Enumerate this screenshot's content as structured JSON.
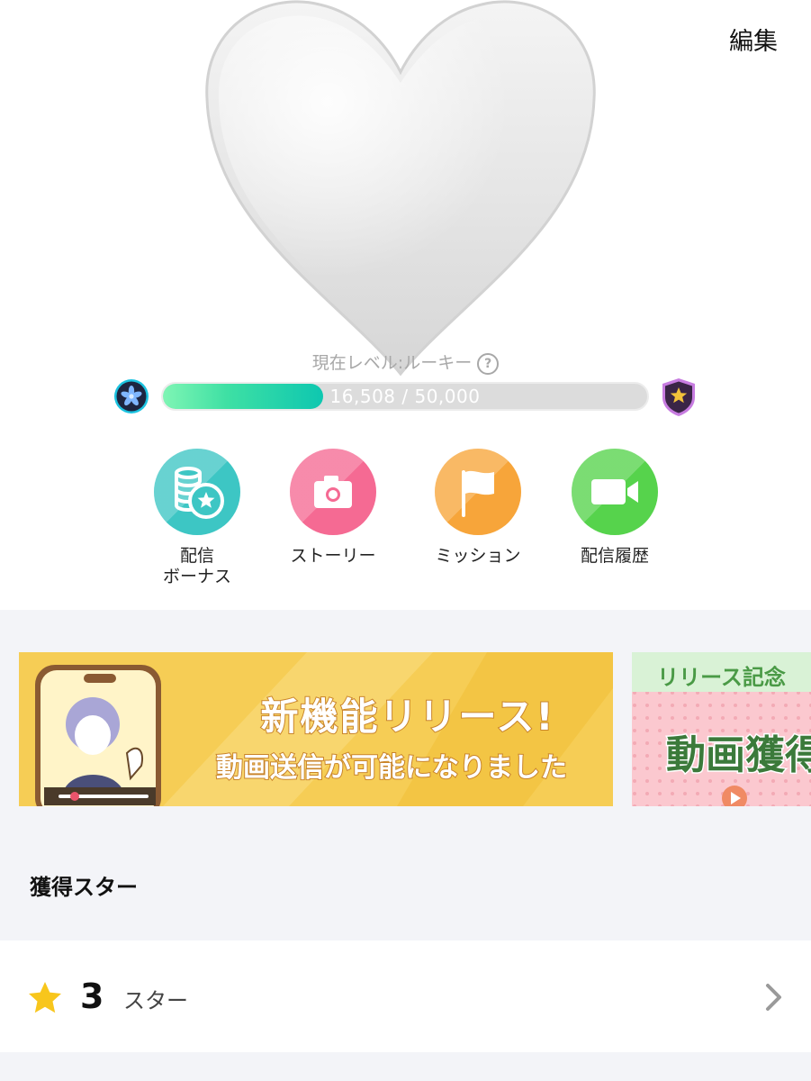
{
  "header": {
    "edit_label": "編集"
  },
  "level": {
    "label": "現在レベル:ルーキー",
    "help_icon": "question-circle-icon",
    "progress_text": "16,508 / 50,000",
    "current": 16508,
    "target": 50000
  },
  "menu": [
    {
      "name": "streaming-bonus",
      "label": "配信\nボーナス",
      "icon": "coins-star-icon",
      "color": "#3dc6c4"
    },
    {
      "name": "story",
      "label": "ストーリー",
      "icon": "camera-icon",
      "color": "#f56a93"
    },
    {
      "name": "mission",
      "label": "ミッション",
      "icon": "flag-icon",
      "color": "#f7a53a"
    },
    {
      "name": "stream-history",
      "label": "配信履歴",
      "icon": "video-camera-icon",
      "color": "#56d34c"
    }
  ],
  "banners": [
    {
      "title": "新機能リリース!",
      "subtitle": "動画送信が可能になりました"
    },
    {
      "top": "リリース記念",
      "title": "動画獲得"
    }
  ],
  "stars": {
    "section_title": "獲得スター",
    "count": "3",
    "unit": "スター"
  },
  "colors": {
    "progress_fill": "#2ed8a8",
    "gray_background": "#f3f4f8",
    "banner_yellow": "#f6cd55",
    "star_yellow": "#f8c61c"
  }
}
